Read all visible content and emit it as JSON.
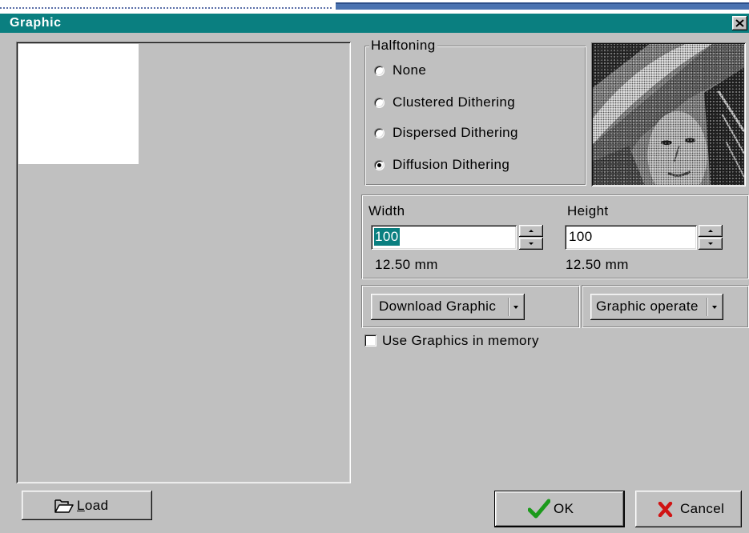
{
  "window": {
    "title": "Graphic"
  },
  "icons": {
    "close": "close-icon",
    "load": "folder-open-icon",
    "ok": "checkmark-icon",
    "cancel": "x-icon",
    "spin_up": "arrow-up-icon",
    "spin_down": "arrow-down-icon",
    "dropdown": "chevron-down-icon"
  },
  "halftoning": {
    "label": "Halftoning",
    "options": [
      {
        "label": "None",
        "selected": false
      },
      {
        "label": "Clustered Dithering",
        "selected": false
      },
      {
        "label": "Dispersed Dithering",
        "selected": false
      },
      {
        "label": "Diffusion Dithering",
        "selected": true
      }
    ]
  },
  "size": {
    "width_label": "Width",
    "width_value": "100",
    "width_selected": true,
    "width_mm": "12.50 mm",
    "height_label": "Height",
    "height_value": "100",
    "height_selected": false,
    "height_mm": "12.50 mm"
  },
  "actions": {
    "download_label": "Download Graphic",
    "operate_label": "Graphic operate"
  },
  "memory": {
    "label": "Use Graphics in memory",
    "checked": false
  },
  "footer": {
    "load_label": "Load",
    "ok_label": "OK",
    "cancel_label": "Cancel"
  },
  "colors": {
    "title_bar": "#0a7f80",
    "face": "#c0c0c0",
    "selection": "#0a7f80",
    "ok_check": "#1c9a1c",
    "cancel_x": "#d01414",
    "desktop_bar": "#4a72b0"
  }
}
